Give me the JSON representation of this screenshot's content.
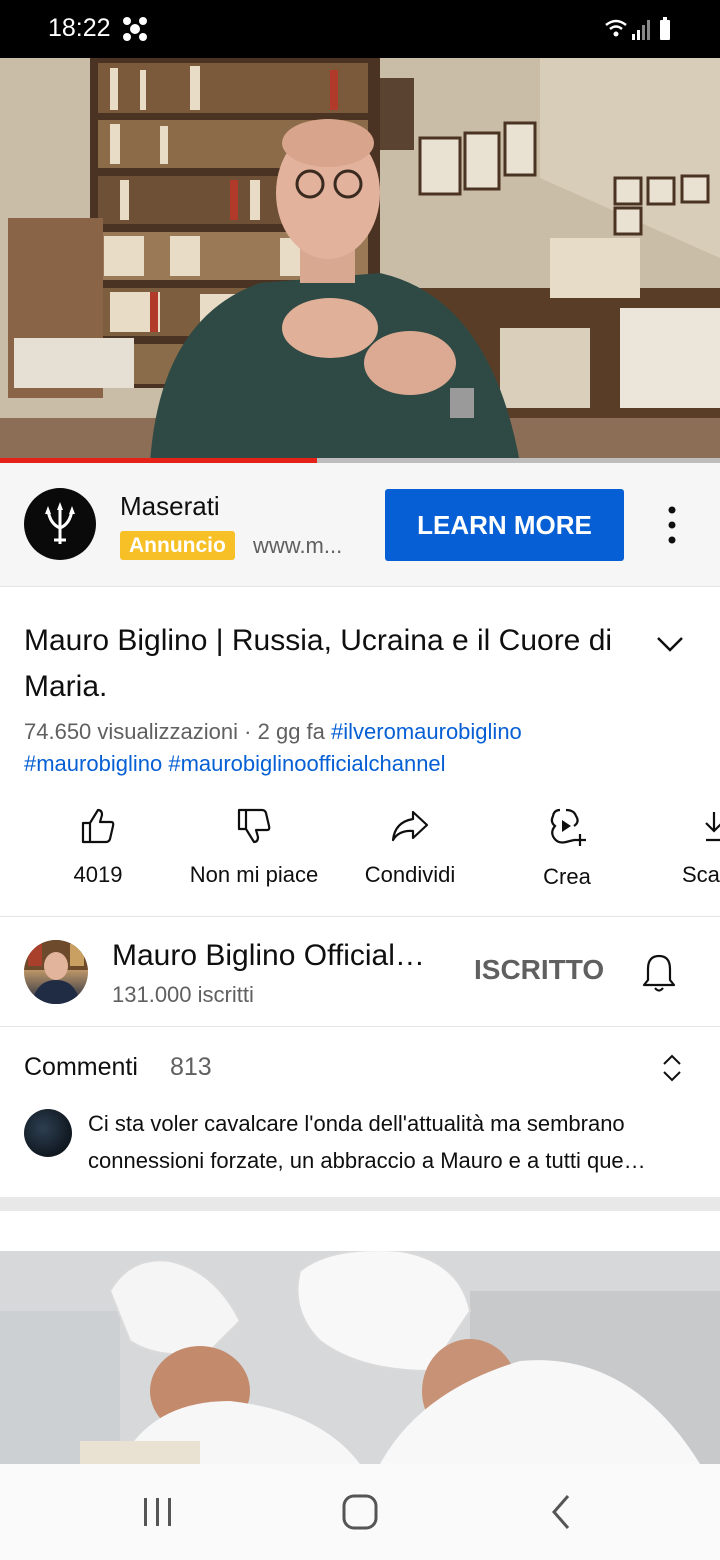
{
  "status_bar": {
    "time": "18:22"
  },
  "player": {
    "progress_fraction": 0.44
  },
  "ad": {
    "advertiser": "Maserati",
    "badge": "Annuncio",
    "url": "www.m...",
    "cta": "LEARN MORE"
  },
  "video": {
    "title": "Mauro Biglino | Russia, Ucraina e il Cuore di Maria.",
    "views": "74.650 visualizzazioni",
    "age": "2 gg fa",
    "hashtags": [
      "#ilveromaurobiglino",
      "#maurobiglino",
      "#maurobiglinoofficialchannel"
    ]
  },
  "actions": {
    "like": "4019",
    "dislike": "Non mi piace",
    "share": "Condividi",
    "create": "Crea",
    "download": "Sca"
  },
  "channel": {
    "name": "Mauro Biglino Official…",
    "subscribers": "131.000 iscritti",
    "subscribe_state": "ISCRITTO"
  },
  "comments": {
    "title": "Commenti",
    "count": "813",
    "top_comment_line1": "Ci sta voler cavalcare l'onda dell'attualità ma sembrano",
    "top_comment_line2": "connessioni forzate, un abbraccio a Mauro e a tutti que…"
  },
  "colors": {
    "accent_blue": "#065fd4",
    "progress_red": "#e62117",
    "badge_yellow": "#f6c026"
  }
}
